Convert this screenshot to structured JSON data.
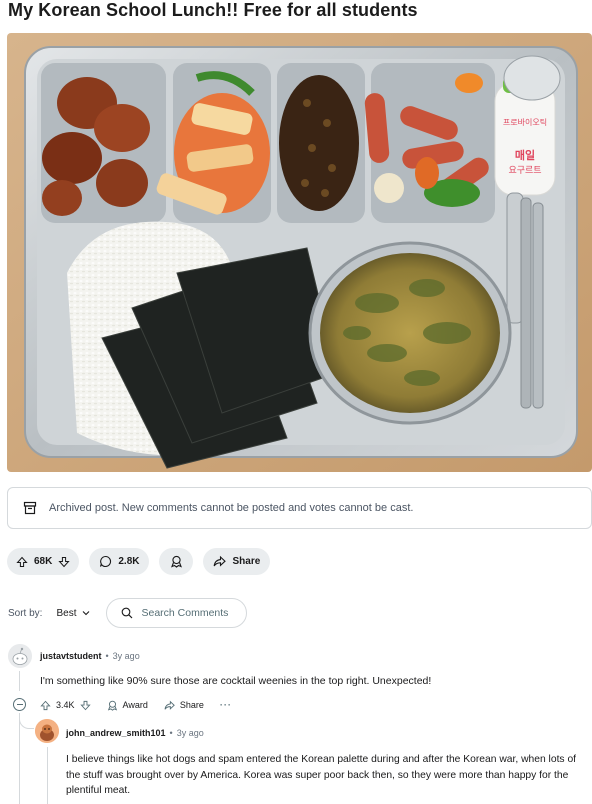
{
  "post": {
    "title": "My Korean School Lunch!! Free for all students",
    "image_alt": "Stainless steel school lunch tray with braised chicken, kimchi, seasoned beans, sausages, rice, roasted seaweed, soup and a yogurt drink",
    "yogurt_label_top": "프로바이오틱",
    "yogurt_label_main": "매일\n요구르트"
  },
  "archived_notice": "Archived post. New comments cannot be posted and votes cannot be cast.",
  "actions": {
    "votes": "68K",
    "comments": "2.8K",
    "share": "Share"
  },
  "sort": {
    "label": "Sort by:",
    "value": "Best",
    "search_placeholder": "Search Comments"
  },
  "comments": [
    {
      "user": "justavtstudent",
      "age": "3y ago",
      "body": "I'm something like 90% sure those are cocktail weenies in the top right. Unexpected!",
      "votes": "3.4K",
      "award": "Award",
      "share": "Share",
      "more": "···"
    },
    {
      "user": "john_andrew_smith101",
      "age": "3y ago",
      "body": "I believe things like hot dogs and spam entered the Korean palette during and after the Korean war, when lots of the stuff was brought over by America. Korea was super poor back then, so they were more than happy for the plentiful meat."
    }
  ],
  "colors": {
    "pill_bg": "#eaedef",
    "border": "#d5d9dc",
    "muted": "#576f76",
    "tray": "#c9ced2"
  }
}
